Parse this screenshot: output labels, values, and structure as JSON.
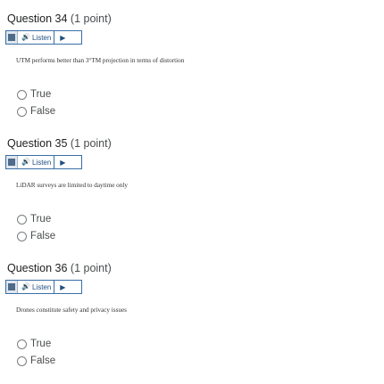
{
  "questions": [
    {
      "title": "Question 34",
      "points": "(1 point)",
      "listen_label": "Listen",
      "play_glyph": "▶",
      "speaker_glyph": "🔊",
      "text": "UTM performs better than 3°TM projection in terms of distortion",
      "options": [
        "True",
        "False"
      ]
    },
    {
      "title": "Question 35",
      "points": "(1 point)",
      "listen_label": "Listen",
      "play_glyph": "▶",
      "speaker_glyph": "🔊",
      "text": "LiDAR surveys are limited to daytime only",
      "options": [
        "True",
        "False"
      ]
    },
    {
      "title": "Question 36",
      "points": "(1 point)",
      "listen_label": "Listen",
      "play_glyph": "▶",
      "speaker_glyph": "🔊",
      "text": "Drones constitute safety and privacy issues",
      "options": [
        "True",
        "False"
      ]
    }
  ]
}
